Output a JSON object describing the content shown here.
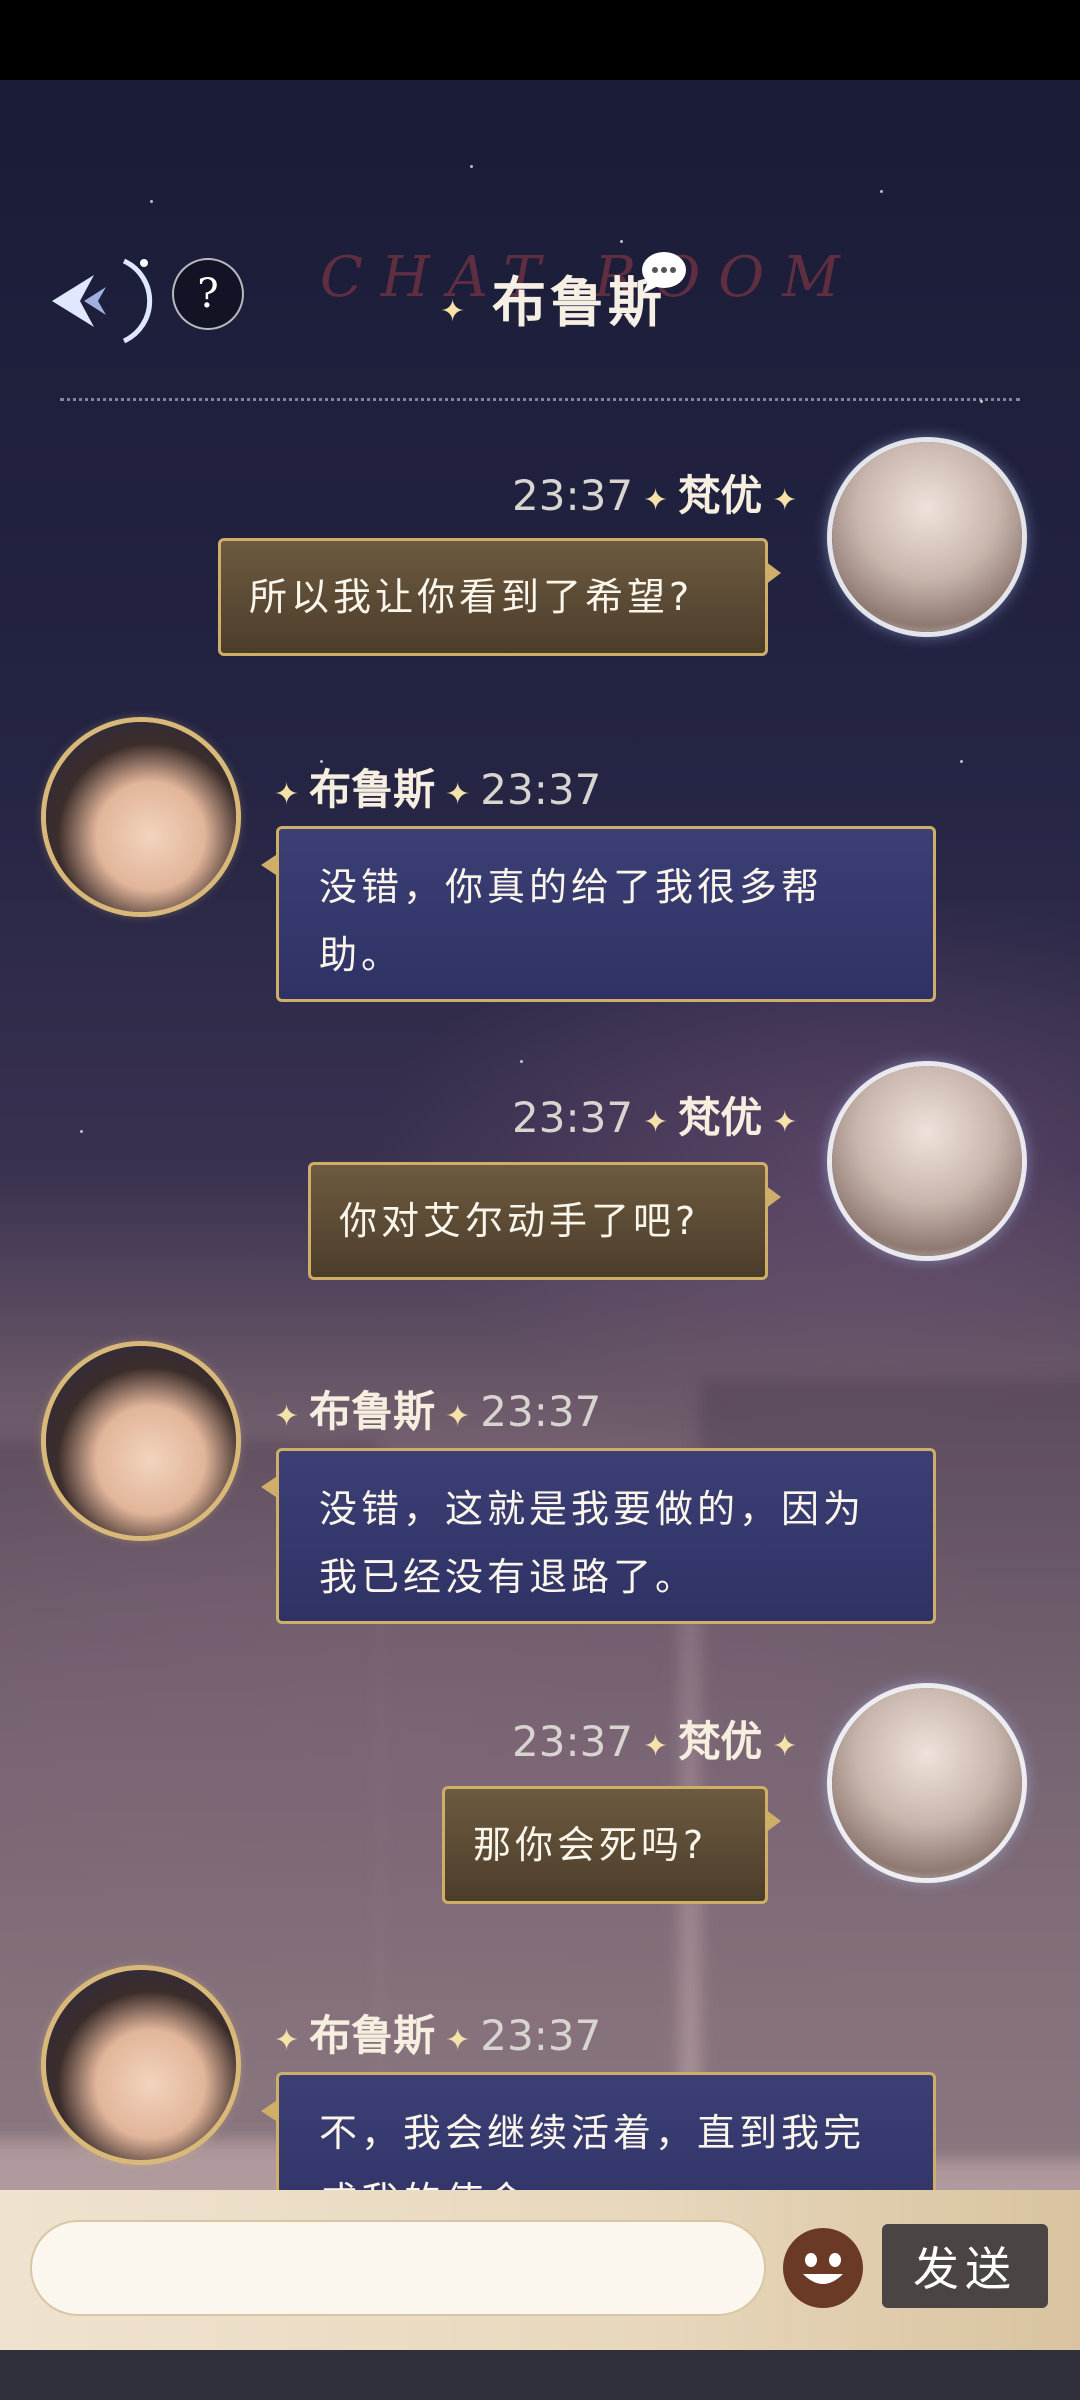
{
  "header": {
    "title": "布鲁斯",
    "watermark": "CHAT ROOM",
    "help_label": "?"
  },
  "messages": [
    {
      "side": "right",
      "sender": "梵优",
      "time": "23:37",
      "text": "所以我让你看到了希望?"
    },
    {
      "side": "left",
      "sender": "布鲁斯",
      "time": "23:37",
      "text": "没错，你真的给了我很多帮助。"
    },
    {
      "side": "right",
      "sender": "梵优",
      "time": "23:37",
      "text": "你对艾尔动手了吧?"
    },
    {
      "side": "left",
      "sender": "布鲁斯",
      "time": "23:37",
      "text": "没错，这就是我要做的，因为我已经没有退路了。"
    },
    {
      "side": "right",
      "sender": "梵优",
      "time": "23:37",
      "text": "那你会死吗?"
    },
    {
      "side": "left",
      "sender": "布鲁斯",
      "time": "23:37",
      "text": "不，我会继续活着，直到我完成我的使命。"
    }
  ],
  "composer": {
    "input_value": "",
    "send_label": "发送"
  },
  "icons": {
    "back": "back-arrow-icon",
    "help": "help-icon",
    "emoji": "emoji-icon",
    "chat": "chat-bubble-icon"
  },
  "colors": {
    "bubble_gold_border": "#cfae69",
    "bubble_gold_fill": "#5c4b35",
    "bubble_blue_fill": "#343769",
    "send_button": "#4a4543",
    "emoji_button": "#6a3a26"
  }
}
